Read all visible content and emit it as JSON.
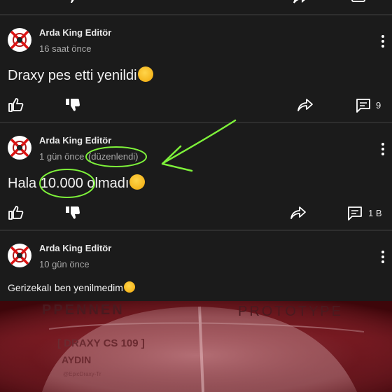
{
  "colors": {
    "background": "#141414",
    "card": "#1b1b1b",
    "annotation": "#7ef23a",
    "photo_tint": "#6d1219"
  },
  "comments": [
    {
      "author": "Arda King Editör",
      "time": "16 saat önce",
      "text": "Draxy pes etti yenildi",
      "emoji": "rolling-on-floor-laughing",
      "reply_count": "9"
    },
    {
      "author": "Arda King Editör",
      "time": "1 gün önce",
      "edited": "(düzenlendi)",
      "text_prefix": "Hala ",
      "text_highlight": "10.000",
      "text_suffix": " olmadı",
      "emoji": "rolling-on-floor-laughing",
      "reply_count": "1 B"
    },
    {
      "author": "Arda King Editör",
      "time": "10 gün önce",
      "text": "Gerizekalı ben yenilmedim",
      "emoji": "grinning-squinting-face"
    }
  ],
  "photo": {
    "label_left": "PPENNEN",
    "label_right": "PROTOTYPE",
    "tag_line1": "[ DRAXY CS 109 ]",
    "tag_line2": "AYDIN",
    "tag_line3": "@EpicDraxy-Tr"
  }
}
